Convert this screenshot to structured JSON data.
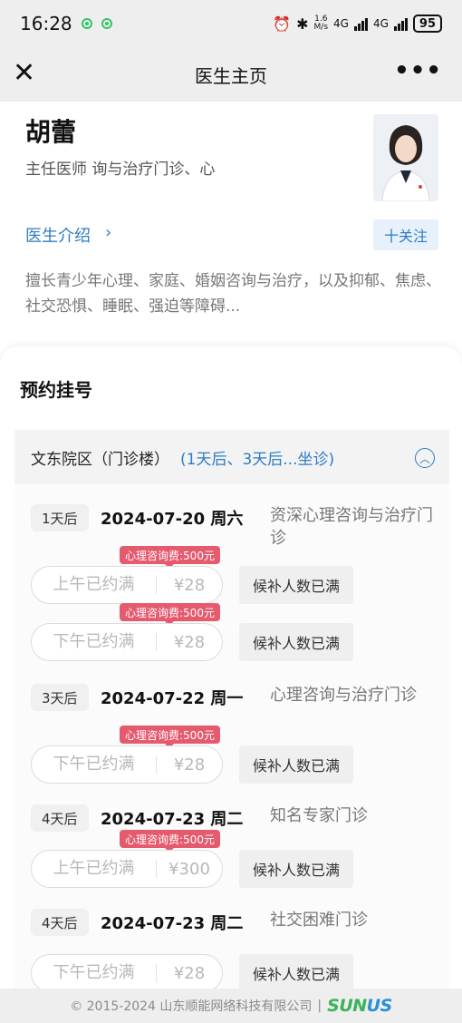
{
  "status_bar": {
    "time": "16:28",
    "speed_value": "1.6",
    "speed_unit": "M/s",
    "net1": "4G",
    "net2": "4G",
    "battery": "95"
  },
  "nav": {
    "title": "医生主页"
  },
  "doctor": {
    "name": "胡蕾",
    "title_line": "主任医师 询与治疗门诊、心",
    "intro_link": "医生介绍",
    "follow_button": "十关注",
    "expertise": "擅长青少年心理、家庭、婚姻咨询与治疗，以及抑郁、焦虑、社交恐惧、睡眠、强迫等障碍..."
  },
  "booking": {
    "title": "预约挂号",
    "campus": {
      "name": "文东院区（门诊楼）",
      "schedule": "(1天后、3天后...坐诊)"
    },
    "days": [
      {
        "badge": "1天后",
        "date": "2024-07-20 周六",
        "clinic": "资深心理咨询与治疗门诊",
        "slots": [
          {
            "label": "上午已约满",
            "price": "¥28",
            "tag": "心理咨询费:500元",
            "waitlist": "候补人数已满"
          },
          {
            "label": "下午已约满",
            "price": "¥28",
            "tag": "心理咨询费:500元",
            "waitlist": "候补人数已满"
          }
        ]
      },
      {
        "badge": "3天后",
        "date": "2024-07-22 周一",
        "clinic": "心理咨询与治疗门诊",
        "slots": [
          {
            "label": "下午已约满",
            "price": "¥28",
            "tag": "心理咨询费:500元",
            "waitlist": "候补人数已满"
          }
        ]
      },
      {
        "badge": "4天后",
        "date": "2024-07-23 周二",
        "clinic": "知名专家门诊",
        "slots": [
          {
            "label": "上午已约满",
            "price": "¥300",
            "tag": "心理咨询费:500元",
            "waitlist": "候补人数已满"
          }
        ]
      },
      {
        "badge": "4天后",
        "date": "2024-07-23 周二",
        "clinic": "社交困难门诊",
        "slots": [
          {
            "label": "下午已约满",
            "price": "¥28",
            "tag": "",
            "waitlist": "候补人数已满"
          }
        ]
      }
    ]
  },
  "footer": {
    "copyright": "© 2015-2024 山东顺能网络科技有限公司",
    "separator": "|",
    "brand_a": "SUN",
    "brand_b": "US"
  },
  "colors": {
    "accent": "#2e7bc4",
    "tag": "#e65a6e",
    "brand_green": "#3bb35b"
  }
}
